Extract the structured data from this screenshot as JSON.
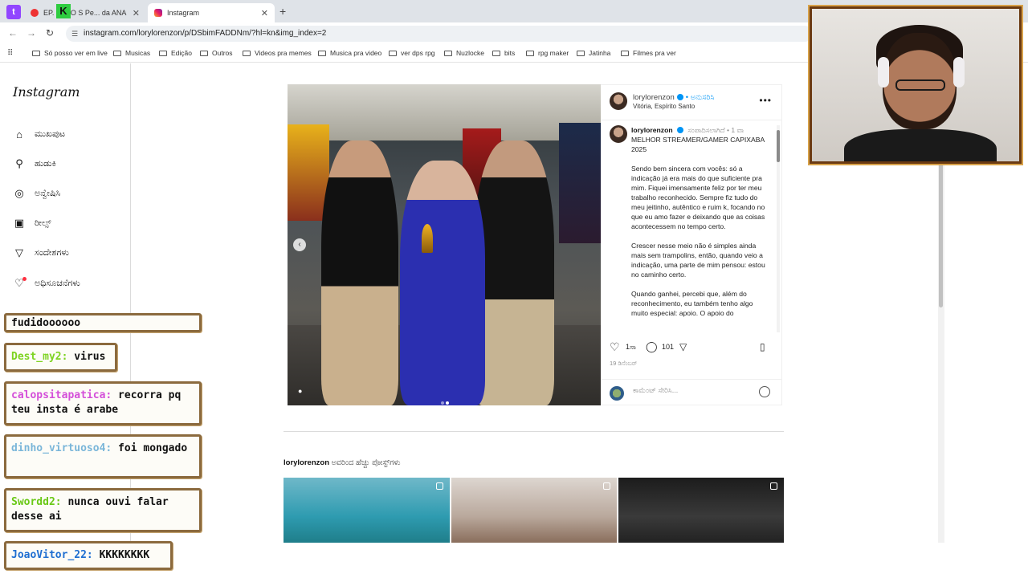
{
  "browser": {
    "tabs": [
      {
        "label": "EP. 06 - O S Pe... da ANA",
        "active": false
      },
      {
        "label": "Instagram",
        "active": true
      }
    ],
    "url": "instagram.com/lorylorenzon/p/DSbimFADDNm/?hl=kn&img_index=2",
    "bookmarks": [
      "Só posso ver em live",
      "Musicas",
      "Edição",
      "Outros",
      "Videos pra memes",
      "Musica pra video",
      "ver dps rpg",
      "Nuzlocke",
      "bits",
      "rpg maker",
      "Jatinha",
      "Filmes pra ver"
    ]
  },
  "sidebar": {
    "logo": "Instagram",
    "items": [
      {
        "label": "ಮುಖಪುಟ",
        "icon": "home-icon",
        "glyph": "⌂"
      },
      {
        "label": "ಹುಡುಕಿ",
        "icon": "search-icon",
        "glyph": "⚲"
      },
      {
        "label": "ಅನ್ವೇಷಿಸಿ",
        "icon": "compass-icon",
        "glyph": "◎"
      },
      {
        "label": "ರೀಲ್ಸ್",
        "icon": "reels-icon",
        "glyph": "▣"
      },
      {
        "label": "ಸಂದೇಶಗಳು",
        "icon": "send-icon",
        "glyph": "▽"
      },
      {
        "label": "ಅಧಿಸೂಚನೆಗಳು",
        "icon": "heart-icon",
        "glyph": "♡"
      }
    ]
  },
  "post": {
    "username": "lorylorenzon",
    "follow_label": "• ಅನುಸರಿಸಿ",
    "location": "Vitória, Espírito Santo",
    "caption_user": "lorylorenzon",
    "edited": "ಸಂಪಾದಿಸಲಾಗಿದೆ",
    "age": "• 1 ವಾ",
    "caption_title": "MELHOR STREAMER/GAMER CAPIXABA 2025",
    "paragraphs": [
      "Sendo bem sincera com vocês: só a indicação já era mais do que suficiente pra mim. Fiquei imensamente feliz por ter meu trabalho reconhecido. Sempre fiz tudo do meu jeitinho, autêntico e ruim k, focando no que eu amo fazer e deixando que as coisas acontecessem no tempo certo.",
      "Crescer nesse meio não é simples ainda mais sem trampolins, então, quando veio a indicação, uma parte de mim pensou: estou no caminho certo.",
      "Quando ganhei, percebi que, além do reconhecimento, eu também tenho algo muito especial: apoio. O apoio do"
    ],
    "likes": "1ಸಾ",
    "comments": "101",
    "date": "19 ಡಿಸೆಂಬರ್",
    "comment_placeholder": "ಕಾಮೆಂಟ್ ಸೇರಿಸಿ..."
  },
  "more_posts": {
    "user": "lorylorenzon",
    "label": " ಅವರಿಂದ ಹೆಚ್ಚು ಪೋಸ್ಟ್‌ಗಳು"
  },
  "chat": [
    {
      "user": "",
      "message": "fudidoooooo"
    },
    {
      "user": "Dest_my2:",
      "message": " virus"
    },
    {
      "user": "calopsitapatica:",
      "message": " recorra pq teu insta é arabe"
    },
    {
      "user": "dinho_virtuoso4:",
      "message": " foi mongado"
    },
    {
      "user": "Swordd2:",
      "message": " nunca ouvi falar desse ai"
    },
    {
      "user": "JoaoVitor_22:",
      "message": " KKKKKKKK"
    }
  ]
}
